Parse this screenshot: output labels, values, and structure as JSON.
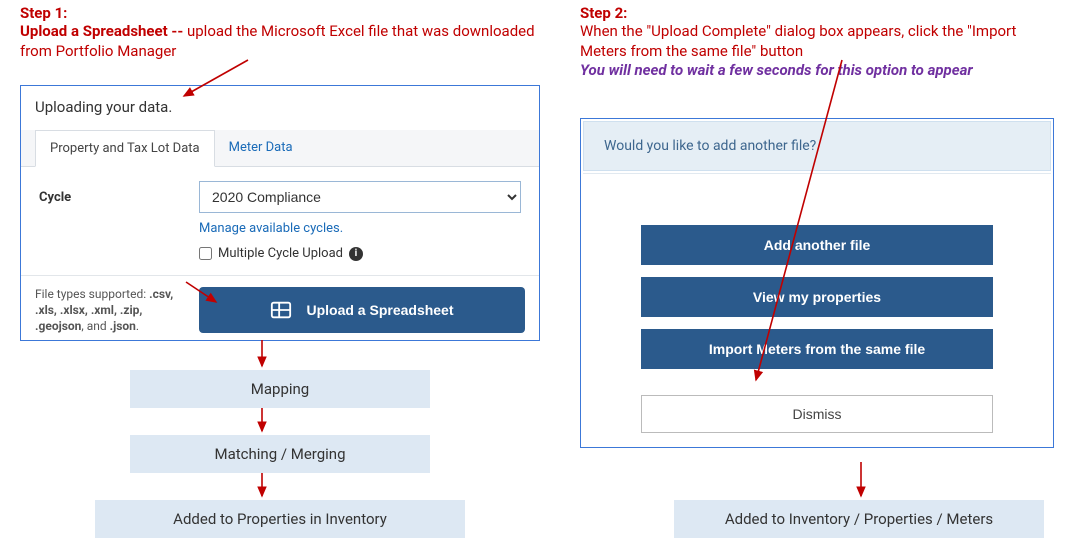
{
  "step1": {
    "label": "Step 1:",
    "bold_lead": "Upload a Spreadsheet -- ",
    "rest": "upload the Microsoft Excel file that was downloaded from Portfolio Manager",
    "panel_title": "Uploading your data.",
    "tab_property": "Property and Tax Lot Data",
    "tab_meter": "Meter Data",
    "cycle_label": "Cycle",
    "cycle_value": "2020 Compliance",
    "manage_link": "Manage available cycles.",
    "multi_label": "Multiple Cycle Upload",
    "filetypes_prefix": "File types supported: ",
    "filetypes_bold": ".csv, .xls, .xlsx, .xml, .zip, .geojson",
    "filetypes_suffix": ", and ",
    "filetypes_bold2": ".json",
    "upload_btn": "Upload a Spreadsheet",
    "flow_mapping": "Mapping",
    "flow_matching": "Matching / Merging",
    "flow_added": "Added to Properties in Inventory"
  },
  "step2": {
    "label": "Step 2:",
    "text": "When the \"Upload Complete\" dialog box appears, click the \"Import Meters from the same file\" button",
    "note": "You will need to wait a few seconds for this option to appear",
    "panel_title": "Would you like to add another file?",
    "btn_add": "Add another file",
    "btn_view": "View my properties",
    "btn_import": "Import Meters from the same file",
    "btn_dismiss": "Dismiss",
    "flow_added": "Added to Inventory / Properties / Meters"
  }
}
